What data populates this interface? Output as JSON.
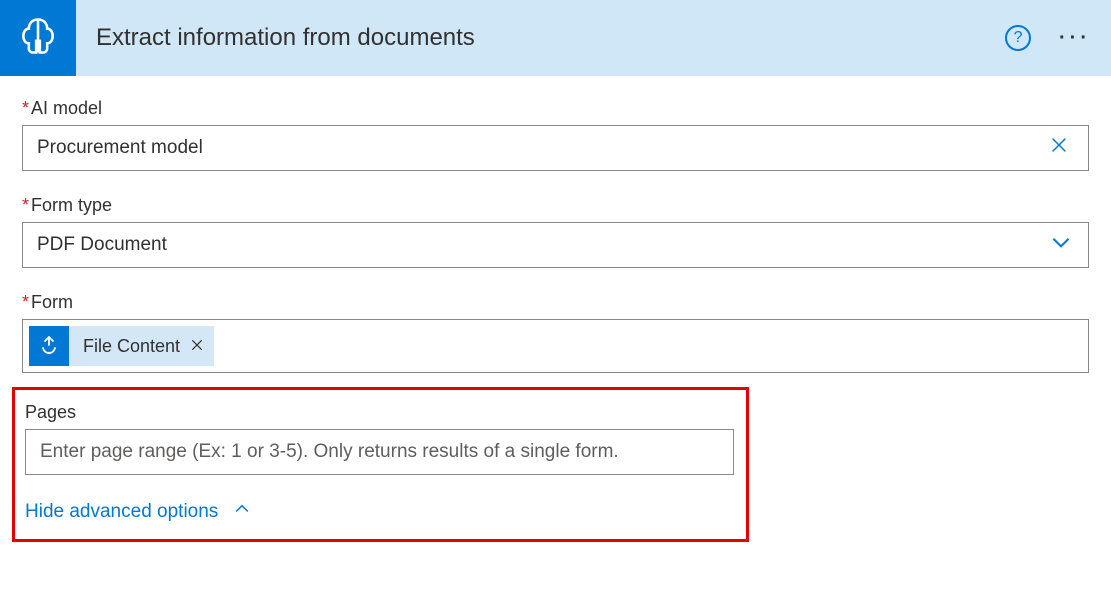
{
  "header": {
    "title": "Extract information from documents",
    "help_label": "?",
    "more_label": "···"
  },
  "fields": {
    "ai_model": {
      "label": "AI model",
      "required": true,
      "value": "Procurement model"
    },
    "form_type": {
      "label": "Form type",
      "required": true,
      "value": "PDF Document"
    },
    "form": {
      "label": "Form",
      "required": true,
      "token_label": "File Content"
    },
    "pages": {
      "label": "Pages",
      "placeholder": "Enter page range (Ex: 1 or 3-5). Only returns results of a single form."
    }
  },
  "footer": {
    "hide_advanced": "Hide advanced options"
  }
}
